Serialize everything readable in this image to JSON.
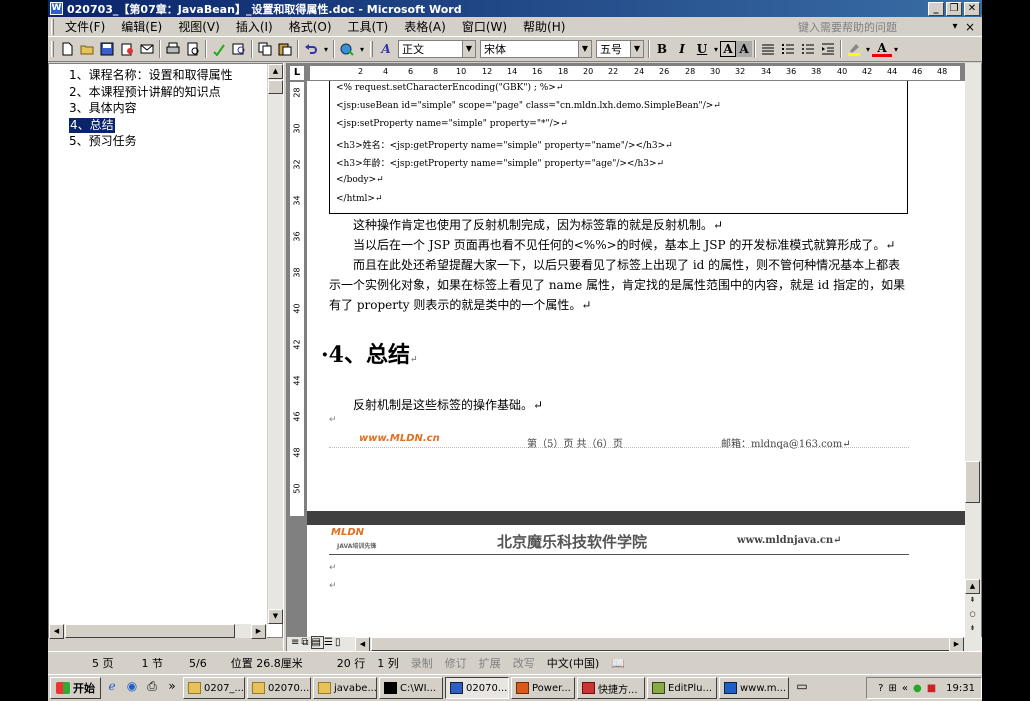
{
  "window": {
    "title": "020703_【第07章：JavaBean】_设置和取得属性.doc - Microsoft Word",
    "min_label": "_",
    "restore_label": "❐",
    "close_label": "✕"
  },
  "menu": {
    "items": [
      "文件(F)",
      "编辑(E)",
      "视图(V)",
      "插入(I)",
      "格式(O)",
      "工具(T)",
      "表格(A)",
      "窗口(W)",
      "帮助(H)"
    ],
    "help_placeholder": "键入需要帮助的问题",
    "drop_label": "▾",
    "close_label": "×"
  },
  "toolbar": {
    "style_value": "正文",
    "font_value": "宋体",
    "size_value": "五号",
    "style_icon": "A",
    "bold_label": "B",
    "italic_label": "I",
    "underline_label": "U",
    "border_label": "A",
    "shade_label": "A",
    "font_color_label": "A"
  },
  "docmap": {
    "items": [
      {
        "label": "1、课程名称：设置和取得属性",
        "selected": false
      },
      {
        "label": "2、本课程预计讲解的知识点",
        "selected": false
      },
      {
        "label": "3、具体内容",
        "selected": false
      },
      {
        "label": "4、总结",
        "selected": true
      },
      {
        "label": "5、预习任务",
        "selected": false
      }
    ]
  },
  "ruler": {
    "corner": "L",
    "h_ticks": [
      "2",
      "4",
      "6",
      "8",
      "10",
      "12",
      "14",
      "16",
      "18",
      "20",
      "22",
      "24",
      "26",
      "28",
      "30",
      "32",
      "34",
      "36",
      "38",
      "40",
      "42",
      "44",
      "46",
      "48"
    ],
    "v_ticks": [
      "28",
      "30",
      "32",
      "34",
      "36",
      "38",
      "40",
      "42",
      "44",
      "46",
      "48",
      "50"
    ]
  },
  "document": {
    "code_lines": [
      "<%    request.setCharacterEncoding(\"GBK\") ; %>↵",
      "<jsp:useBean id=\"simple\" scope=\"page\" class=\"cn.mldn.lxh.demo.SimpleBean\"/>↵",
      "<jsp:setProperty name=\"simple\" property=\"*\"/>↵",
      "<h3>姓名：<jsp:getProperty name=\"simple\" property=\"name\"/></h3>↵",
      "<h3>年龄：<jsp:getProperty name=\"simple\" property=\"age\"/></h3>↵",
      "</body>↵",
      "</html>↵"
    ],
    "para1": "这种操作肯定也使用了反射机制完成，因为标签靠的就是反射机制。↵",
    "para2": "当以后在一个 JSP 页面再也看不见任何的<%%>的时候，基本上 JSP 的开发标准模式就算形成了。↵",
    "para3": "而且在此处还希望提醒大家一下，以后只要看见了标签上出现了 id 的属性，则不管何种情况基本上都表示一个实例化对象，如果在标签上看见了 name 属性，肯定找的是属性范围中的内容，就是 id 指定的，如果有了 property 则表示的就是类中的一个属性。↵",
    "heading": "·4、总结",
    "heading_mark": "↵",
    "para4": "反射机制是这些标签的操作基础。↵",
    "cursor_mark": "↵",
    "footer_logo": "www.MLDN.cn",
    "footer_page": "第（5）页    共（6）页",
    "footer_email": "邮箱：mldnqa@163.com↵",
    "page2_logo": "MLDN",
    "page2_logo_sub": "JAVA培训先锋",
    "page2_header": "北京魔乐科技软件学院",
    "page2_url": "www.mldnjava.cn↵",
    "page2_mark1": "↵",
    "page2_mark2": "↵"
  },
  "statusbar": {
    "page": "5 页",
    "section": "1 节",
    "page_of": "5/6",
    "position": "位置 26.8厘米",
    "line": "20 行",
    "col": "1 列",
    "rec": "录制",
    "trk": "修订",
    "ext": "扩展",
    "ovr": "改写",
    "lang": "中文(中国)"
  },
  "taskbar": {
    "start_label": "开始",
    "more_label": "»",
    "tasks": [
      "0207_...",
      "02070...",
      "javabe...",
      "C:\\WI...",
      "02070...",
      "Power...",
      "快捷方...",
      "EditPlu...",
      "www.m..."
    ],
    "active_task": 4,
    "tray_more": "«",
    "clock": "19:31"
  }
}
